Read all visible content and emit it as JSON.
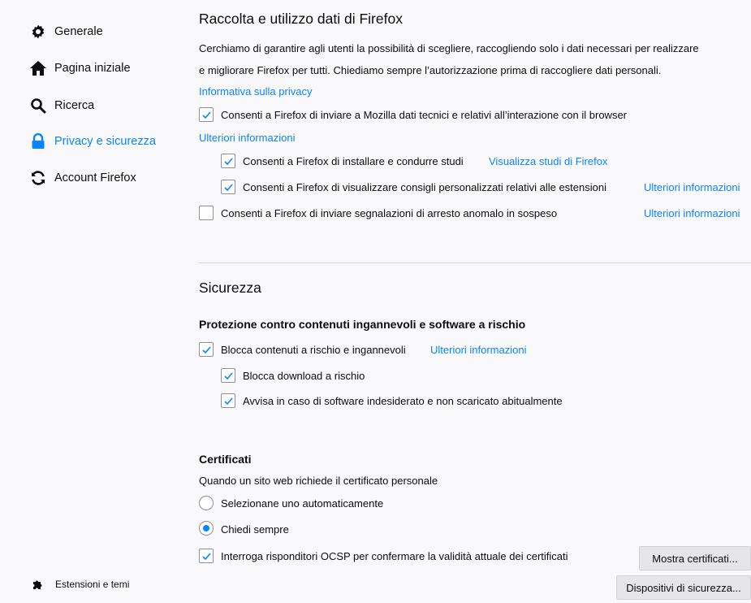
{
  "sidebar": {
    "items": [
      {
        "label": "Generale",
        "icon": "gear-icon"
      },
      {
        "label": "Pagina iniziale",
        "icon": "home-icon"
      },
      {
        "label": "Ricerca",
        "icon": "search-icon"
      },
      {
        "label": "Privacy e sicurezza",
        "icon": "lock-icon",
        "selected": true
      },
      {
        "label": "Account Firefox",
        "icon": "sync-icon"
      }
    ],
    "extensions": {
      "label": "Estensioni e temi",
      "icon": "puzzle-icon"
    }
  },
  "data_collection": {
    "title": "Raccolta e utilizzo dati di Firefox",
    "description_line1": "Cerchiamo di garantire agli utenti la possibilità di scegliere, raccogliendo solo i dati necessari per realizzare",
    "description_line2": "e migliorare Firefox per tutti. Chiediamo sempre l’autorizzazione prima di raccogliere dati personali.",
    "privacy_link": "Informativa sulla privacy",
    "telemetry": {
      "label": "Consenti a Firefox di inviare a Mozilla dati tecnici e relativi all’interazione con il browser",
      "checked": true
    },
    "learn_more": "Ulteriori informazioni",
    "studies": {
      "label": "Consenti a Firefox di installare e condurre studi",
      "checked": true,
      "link": "Visualizza studi di Firefox"
    },
    "recommendations": {
      "label": "Consenti a Firefox di visualizzare consigli personalizzati relativi alle estensioni",
      "checked": true,
      "link": "Ulteriori informazioni"
    },
    "crash_reports": {
      "label": "Consenti a Firefox di inviare segnalazioni di arresto anomalo in sospeso",
      "checked": false,
      "link": "Ulteriori informazioni"
    }
  },
  "security": {
    "title": "Sicurezza",
    "protection_heading": "Protezione contro contenuti ingannevoli e software a rischio",
    "block_dangerous": {
      "label": "Blocca contenuti a rischio e ingannevoli",
      "checked": true,
      "link": "Ulteriori informazioni"
    },
    "block_downloads": {
      "label": "Blocca download a rischio",
      "checked": true
    },
    "warn_unwanted": {
      "label": "Avvisa in caso di software indesiderato e non scaricato abitualmente",
      "checked": true
    }
  },
  "certificates": {
    "heading": "Certificati",
    "description": "Quando un sito web richiede il certificato personale",
    "auto_select": {
      "label": "Selezionane uno automaticamente",
      "selected": false
    },
    "always_ask": {
      "label": "Chiedi sempre",
      "selected": true
    },
    "ocsp": {
      "label": "Interroga risponditori OCSP per confermare la validità attuale dei certificati",
      "checked": true
    },
    "view_certificates_button": "Mostra certificati...",
    "security_devices_button": "Dispositivi di sicurezza..."
  },
  "colors": {
    "accent": "#0a84ff",
    "text": "#0c0c0d",
    "background": "#f9f9fb"
  }
}
